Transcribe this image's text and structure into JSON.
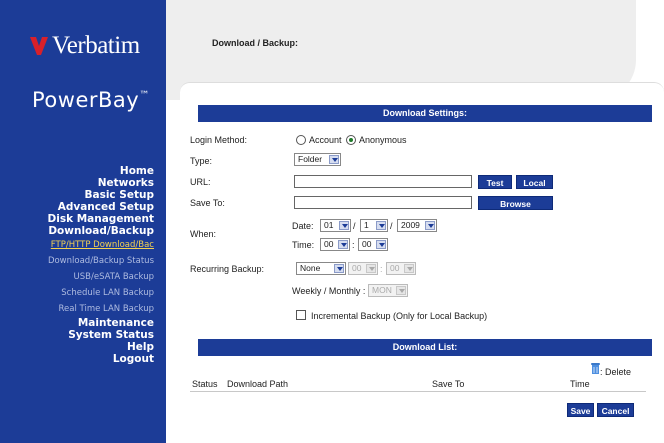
{
  "brand": {
    "logo_text": "Verbatim",
    "product": "PowerBay",
    "product_mark": "™"
  },
  "nav": {
    "home": "Home",
    "networks": "Networks",
    "basic_setup": "Basic Setup",
    "advanced_setup": "Advanced Setup",
    "disk_management": "Disk Management",
    "download_backup": "Download/Backup",
    "ftp_http": "FTP/HTTP Download/Bac",
    "status": "Download/Backup Status",
    "usb_esata": "USB/eSATA Backup",
    "schedule_lan": "Schedule LAN Backup",
    "realtime_lan": "Real Time LAN Backup",
    "maintenance": "Maintenance",
    "system_status": "System Status",
    "help": "Help",
    "logout": "Logout"
  },
  "breadcrumb": "Download / Backup:",
  "settings": {
    "header": "Download Settings:",
    "login_method_label": "Login Method:",
    "account_label": "Account",
    "anonymous_label": "Anonymous",
    "login_method_selected": "Anonymous",
    "type_label": "Type:",
    "type_value": "Folder",
    "url_label": "URL:",
    "url_value": "",
    "test_button": "Test",
    "local_button": "Local",
    "save_to_label": "Save To:",
    "save_to_value": "",
    "browse_button": "Browse",
    "when_label": "When:",
    "date_label": "Date:",
    "date_month": "01",
    "date_day": "1",
    "date_year": "2009",
    "date_sep": "/",
    "time_label": "Time:",
    "time_hour": "00",
    "time_min": "00",
    "time_sep": ":",
    "recurring_label": "Recurring Backup:",
    "recurring_value": "None",
    "recurring_hour": "00",
    "recurring_min": "00",
    "weekly_label": "Weekly / Monthly :",
    "weekly_value": "MON",
    "incremental_label": "Incremental Backup (Only for Local Backup)",
    "incremental_checked": false
  },
  "list": {
    "header": "Download List:",
    "delete_label": ": Delete",
    "columns": [
      "Status",
      "Download Path",
      "Save To",
      "Time"
    ],
    "rows": []
  },
  "actions": {
    "save": "Save",
    "cancel": "Cancel"
  },
  "colors": {
    "brand_blue": "#1c3c97",
    "logo_red": "#d8202a",
    "active_link": "#f4d250"
  }
}
